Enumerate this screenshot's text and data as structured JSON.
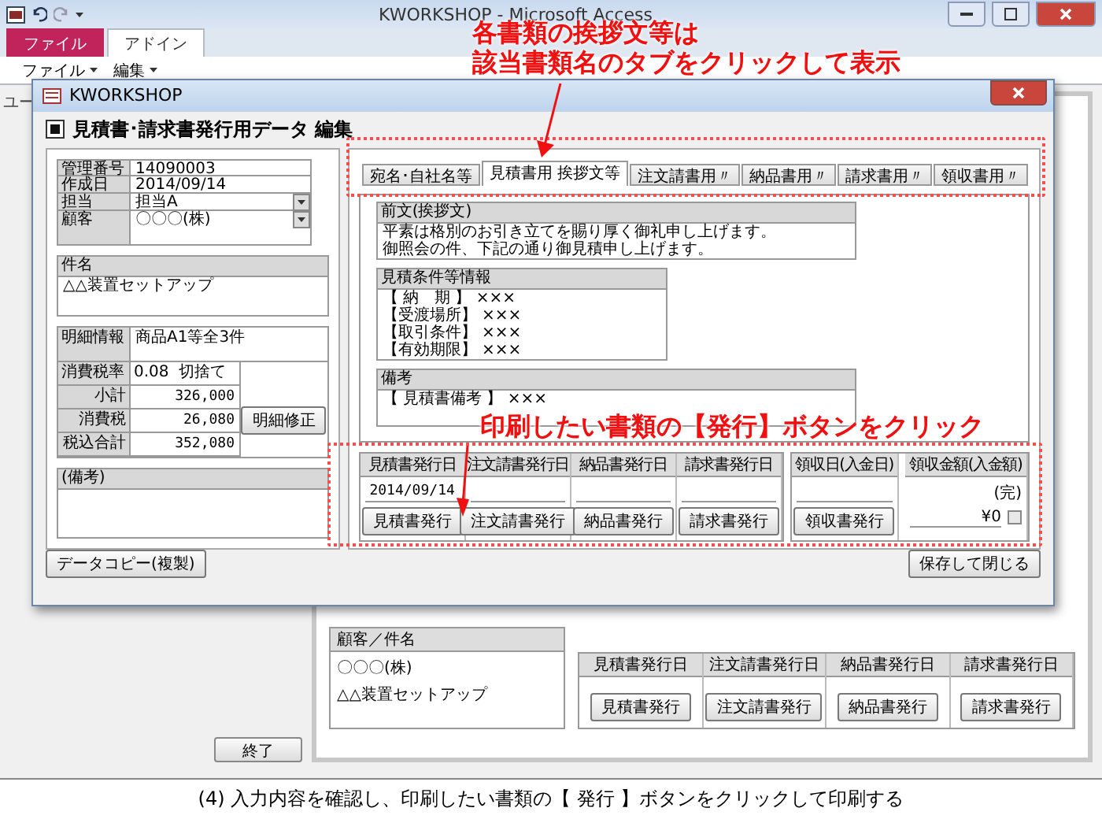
{
  "app_window": {
    "title": "KWORKSHOP - Microsoft Access"
  },
  "ribbon": {
    "tabs": [
      {
        "label": "ファイル",
        "selected": false,
        "kind": "file"
      },
      {
        "label": "アドイン",
        "selected": true,
        "kind": "tab"
      }
    ],
    "menus": [
      "ファイル",
      "編集"
    ]
  },
  "background_form": {
    "side_label": "ユー",
    "customer_header": "顧客／件名",
    "customer": "〇〇〇(株)",
    "subject": "△△装置セットアップ",
    "columns": [
      "見積書発行日",
      "注文請書発行日",
      "納品書発行日",
      "請求書発行日"
    ],
    "buttons": [
      "見積書発行",
      "注文請書発行",
      "納品書発行",
      "請求書発行"
    ],
    "exit_button": "終了"
  },
  "dialog": {
    "title": "KWORKSHOP",
    "heading": "見積書･請求書発行用データ 編集",
    "record": [
      {
        "label": "管理番号",
        "value": "14090003",
        "kind": "text"
      },
      {
        "label": "作成日",
        "value": "2014/09/14",
        "kind": "text"
      },
      {
        "label": "担当",
        "value": "担当A",
        "kind": "dropdown"
      },
      {
        "label": "顧客",
        "value": "〇〇〇(株)",
        "kind": "dropdown"
      }
    ],
    "subject_label": "件名",
    "subject": "△△装置セットアップ",
    "details_label": "明細情報",
    "details": "商品A1等全3件",
    "tax_rate_label": "消費税率",
    "tax_rate": "0.08",
    "rounding": "切捨て",
    "totals": [
      {
        "label": "小計",
        "value": "326,000"
      },
      {
        "label": "消費税",
        "value": "26,080"
      },
      {
        "label": "税込合計",
        "value": "352,080"
      }
    ],
    "details_button": "明細修正",
    "notes_label": "(備考)",
    "copy_button": "データコピー(複製)",
    "tabs": [
      {
        "label": "宛名･自社名等",
        "selected": false
      },
      {
        "label": "見積書用 挨拶文等",
        "selected": true
      },
      {
        "label": "注文請書用〃",
        "selected": false
      },
      {
        "label": "納品書用〃",
        "selected": false
      },
      {
        "label": "請求書用〃",
        "selected": false
      },
      {
        "label": "領収書用〃",
        "selected": false
      }
    ],
    "sections": [
      {
        "label": "前文(挨拶文)",
        "lines": [
          "平素は格別のお引き立てを賜り厚く御礼申し上げます。",
          "御照会の件、下記の通り御見積申し上げます。"
        ],
        "kind": "wide"
      },
      {
        "label": "見積条件等情報",
        "lines": [
          "【 納　期 】 ×××",
          "【受渡場所】 ×××",
          "【取引条件】 ×××",
          "【有効期限】 ×××"
        ],
        "kind": "narrow"
      },
      {
        "label": "備考",
        "lines": [
          "【 見積書備考 】 ×××"
        ],
        "kind": "wide"
      }
    ],
    "issue_columns": [
      {
        "header": "見積書発行日",
        "date": "2014/09/14",
        "button": "見積書発行"
      },
      {
        "header": "注文請書発行日",
        "button": "注文請書発行"
      },
      {
        "header": "納品書発行日",
        "button": "納品書発行"
      },
      {
        "header": "請求書発行日",
        "button": "請求書発行"
      }
    ],
    "receipt": {
      "date_header": "領収日(入金日)",
      "button": "領収書発行",
      "amount_header": "領収金額(入金額)",
      "status": "(完)",
      "amount": "¥0",
      "checked": false
    },
    "save_button": "保存して閉じる"
  },
  "annotations": [
    {
      "lines": [
        "各書類の挨拶文等は",
        "該当書類名のタブをクリックして表示"
      ],
      "kind": "tabs"
    },
    {
      "lines": [
        "印刷したい書類の【発行】ボタンをクリック"
      ],
      "kind": "issue"
    }
  ],
  "caption": "(4) 入力内容を確認し、印刷したい書類の【 発行 】ボタンをクリックして印刷する"
}
